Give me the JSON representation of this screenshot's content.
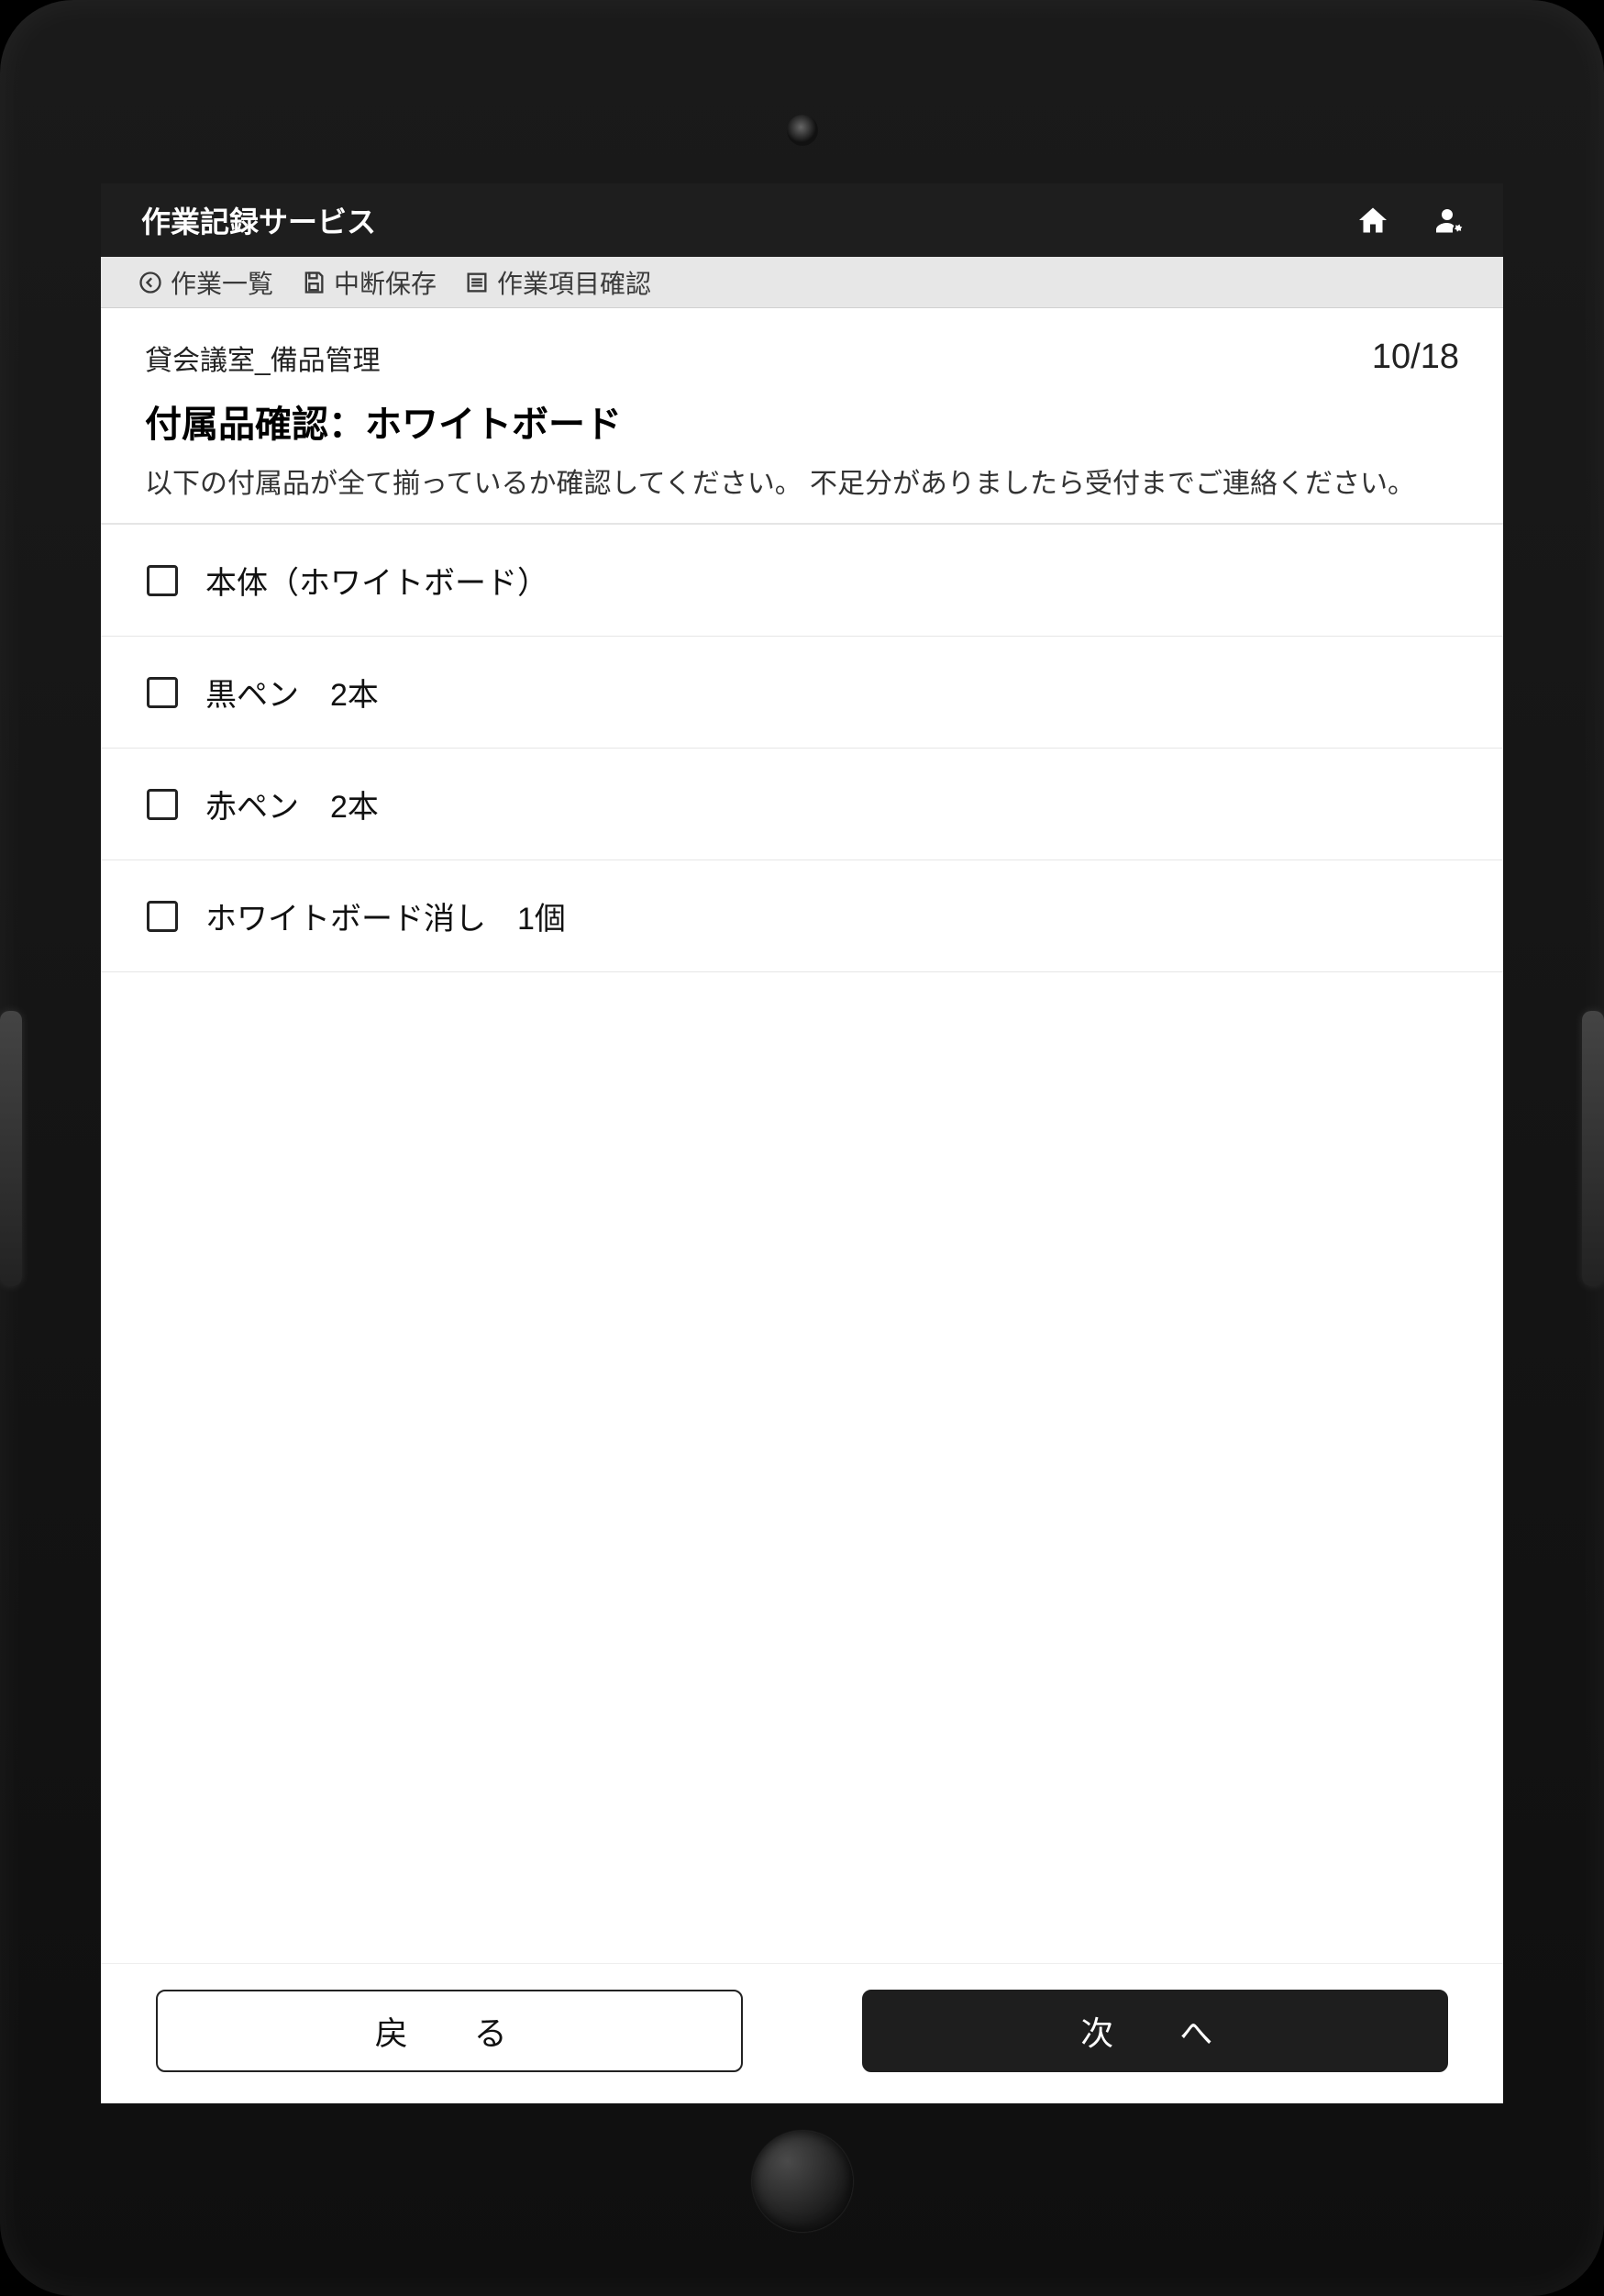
{
  "app": {
    "title": "作業記録サービス"
  },
  "toolbar": {
    "task_list": "作業一覧",
    "pause_save": "中断保存",
    "item_confirm": "作業項目確認"
  },
  "section": {
    "breadcrumb": "貸会議室_備品管理",
    "counter": "10/18",
    "title": "付属品確認：ホワイトボード",
    "description": "以下の付属品が全て揃っているか確認してください。 不足分がありましたら受付までご連絡ください。"
  },
  "checklist": [
    {
      "label": "本体（ホワイトボード）"
    },
    {
      "label": "黒ペン　2本"
    },
    {
      "label": "赤ペン　2本"
    },
    {
      "label": "ホワイトボード消し　1個"
    }
  ],
  "footer": {
    "back": "戻　る",
    "next": "次　へ"
  }
}
